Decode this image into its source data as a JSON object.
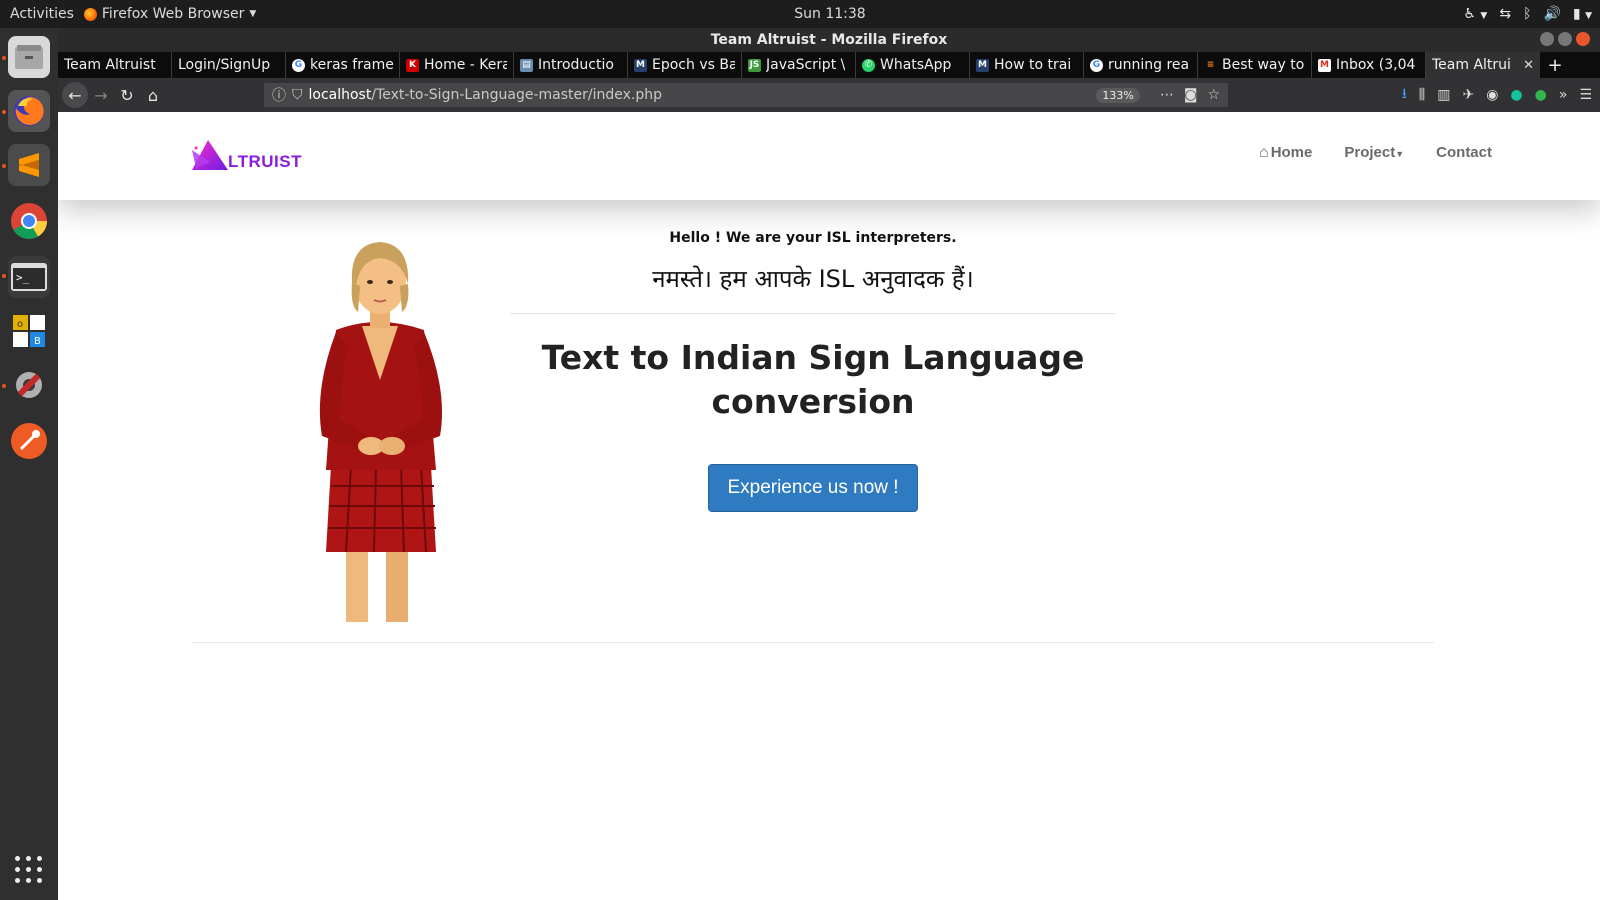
{
  "system": {
    "activities": "Activities",
    "app_name": "Firefox Web Browser",
    "clock": "Sun 11:38"
  },
  "window": {
    "title": "Team Altruist - Mozilla Firefox"
  },
  "tabs": [
    {
      "label": "Team Altruist",
      "icon": "none"
    },
    {
      "label": "Login/SignUp",
      "icon": "none"
    },
    {
      "label": "keras frame",
      "icon": "google-icon"
    },
    {
      "label": "Home - Kera",
      "icon": "keras-icon"
    },
    {
      "label": "Introductio",
      "icon": "page-icon"
    },
    {
      "label": "Epoch vs Ba",
      "icon": "medium-icon"
    },
    {
      "label": "JavaScript \\",
      "icon": "js-icon"
    },
    {
      "label": "WhatsApp",
      "icon": "whatsapp-icon"
    },
    {
      "label": "How to trai",
      "icon": "medium-icon"
    },
    {
      "label": "running rea",
      "icon": "google-icon"
    },
    {
      "label": "Best way to",
      "icon": "stack-icon"
    },
    {
      "label": "Inbox (3,04",
      "icon": "gmail-icon"
    },
    {
      "label": "Team Altrui",
      "icon": "none",
      "active": true
    }
  ],
  "address": {
    "host": "localhost",
    "path": "/Text-to-Sign-Language-master/index.php",
    "zoom": "133%"
  },
  "site": {
    "logo_text": "LTRUIST",
    "nav": {
      "home": "Home",
      "project": "Project",
      "contact": "Contact"
    },
    "hello": "Hello ! We are your ISL interpreters.",
    "hindi": "नमस्ते। हम आपके ISL अनुवादक हैं।",
    "title": "Text to Indian Sign Language conversion",
    "cta": "Experience us now !"
  },
  "colors": {
    "accent_button": "#2f7bc2",
    "logo_purple": "#8a1be0"
  }
}
